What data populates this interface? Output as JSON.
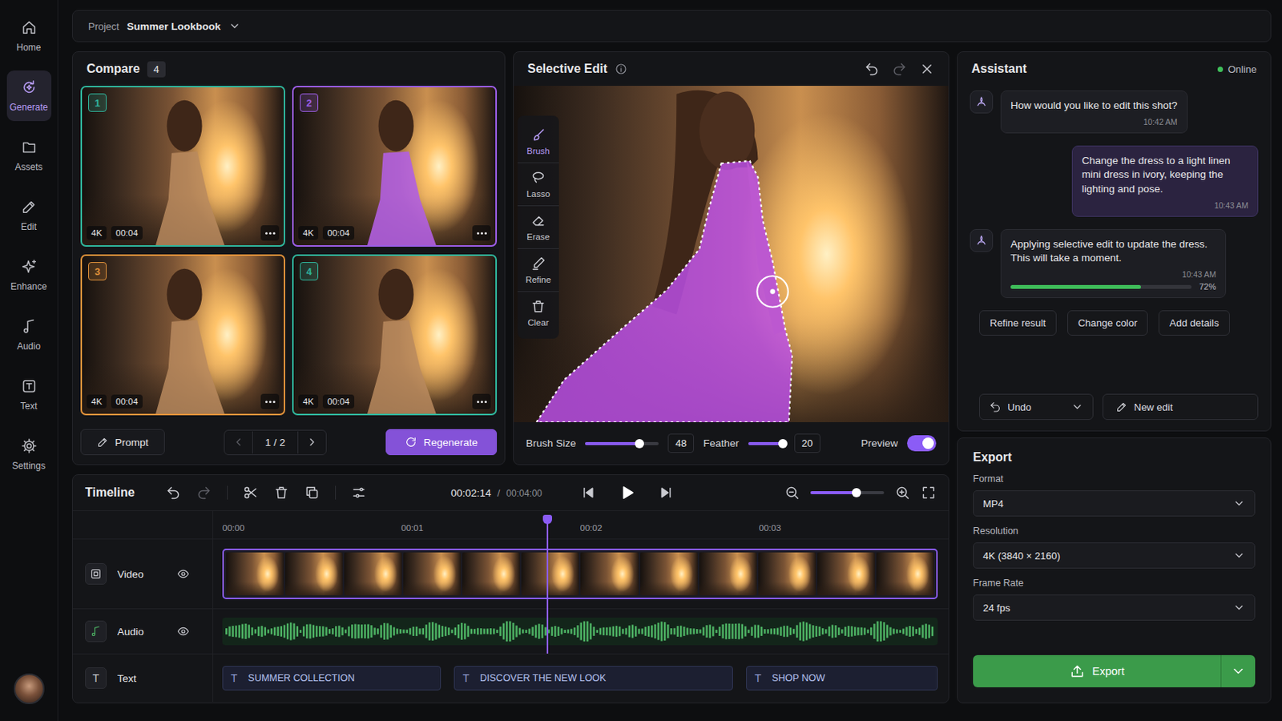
{
  "sidebar": {
    "items": [
      {
        "label": "Home",
        "selected": false
      },
      {
        "label": "Generate",
        "selected": true
      },
      {
        "label": "Assets",
        "selected": false
      },
      {
        "label": "Edit",
        "selected": false
      },
      {
        "label": "Enhance",
        "selected": false
      },
      {
        "label": "Audio",
        "selected": false
      },
      {
        "label": "Text",
        "selected": false
      },
      {
        "label": "Settings",
        "selected": false
      }
    ]
  },
  "topbar": {
    "label": "Project",
    "project": "Summer Lookbook"
  },
  "compare": {
    "title": "Compare",
    "count": "4",
    "variants": [
      {
        "number": "1",
        "resolution": "4K",
        "duration": "00:04",
        "color": "#2fb59c",
        "masked": false
      },
      {
        "number": "2",
        "resolution": "4K",
        "duration": "00:04",
        "color": "#9b5de5",
        "masked": true
      },
      {
        "number": "3",
        "resolution": "4K",
        "duration": "00:04",
        "color": "#e0913a",
        "masked": false
      },
      {
        "number": "4",
        "resolution": "4K",
        "duration": "00:04",
        "color": "#2fb59c",
        "masked": false
      }
    ],
    "prompt_button": "Prompt",
    "page": "1 / 2",
    "regenerate_button": "Regenerate"
  },
  "selective_edit": {
    "title": "Selective Edit",
    "tools": [
      {
        "label": "Brush",
        "selected": true
      },
      {
        "label": "Lasso",
        "selected": false
      },
      {
        "label": "Erase",
        "selected": false
      },
      {
        "label": "Refine",
        "selected": false
      },
      {
        "label": "Clear",
        "selected": false
      }
    ],
    "sliders": [
      {
        "label": "Brush Size",
        "value": "48",
        "level": 0.74
      },
      {
        "label": "Feather",
        "value": "20",
        "level": 0.95
      }
    ],
    "preview": {
      "label": "Preview",
      "on": true
    }
  },
  "timeline": {
    "title": "Timeline",
    "current_time": "00:02:14",
    "separator": "/",
    "total_time": "00:04:00",
    "playhead": 0.46,
    "zoom": 0.62,
    "ruler": [
      "00:00",
      "00:01",
      "00:02",
      "00:03"
    ],
    "tracks": [
      {
        "name": "Video",
        "kind": "video",
        "visible": true
      },
      {
        "name": "Audio",
        "kind": "audio",
        "visible": true
      },
      {
        "name": "Text",
        "kind": "text",
        "icon": "T",
        "clip_icon": "T",
        "clips": [
          "SUMMER COLLECTION",
          "DISCOVER THE NEW LOOK",
          "SHOP NOW"
        ]
      }
    ]
  },
  "assistant": {
    "title": "Assistant",
    "status": "Online",
    "messages": [
      {
        "kind": "assistant",
        "text": "How would you like to edit this shot?",
        "time": "10:42 AM"
      },
      {
        "kind": "user",
        "text": "Change the dress to a light linen mini dress in ivory, keeping the lighting and pose.",
        "time": "10:43 AM"
      },
      {
        "kind": "assistant",
        "text": "Applying selective edit to update the dress. This will take a moment.",
        "time": "10:43 AM",
        "progress": {
          "level": 0.72,
          "reading": "72%"
        }
      }
    ],
    "actions": [
      "Refine result",
      "Change color",
      "Add details"
    ],
    "undo_button": "Undo",
    "new_edit_button": "New edit"
  },
  "export": {
    "title": "Export",
    "fields": [
      {
        "label": "Format",
        "value": "MP4"
      },
      {
        "label": "Resolution",
        "value": "4K (3840 × 2160)"
      },
      {
        "label": "Frame Rate",
        "value": "24 fps"
      }
    ],
    "button": "Export"
  }
}
